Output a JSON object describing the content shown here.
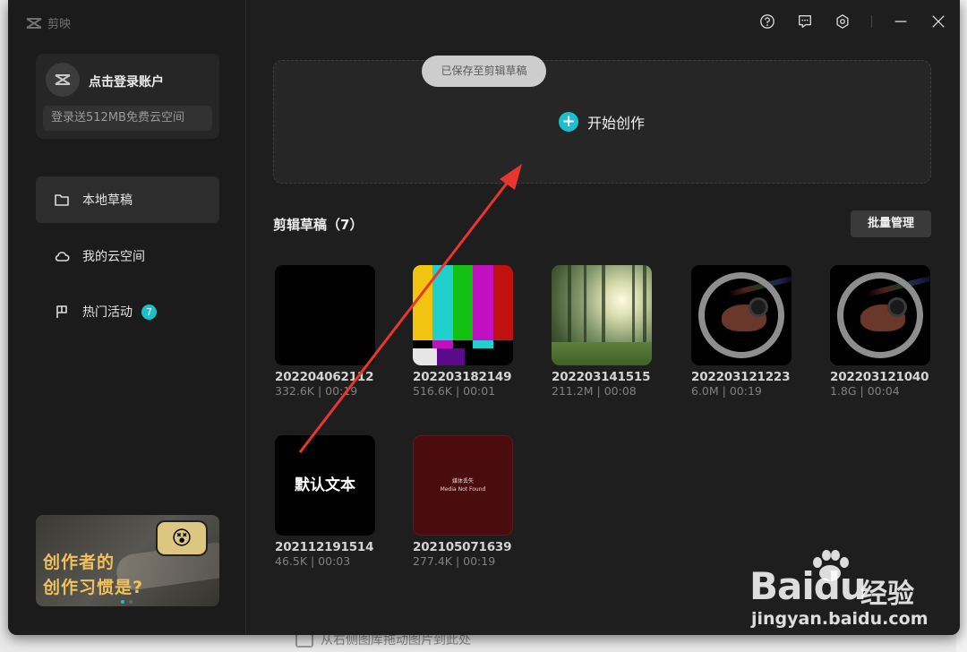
{
  "app": {
    "name": "剪映"
  },
  "account": {
    "login_label": "点击登录账户",
    "promo": "登录送512MB免费云空间"
  },
  "nav": [
    {
      "label": "本地草稿",
      "icon": "folder-icon",
      "active": true
    },
    {
      "label": "我的云空间",
      "icon": "cloud-icon",
      "active": false
    },
    {
      "label": "热门活动",
      "icon": "flag-icon",
      "active": false,
      "badge": "7"
    }
  ],
  "banner": {
    "line1": "创作者的",
    "line2": "创作习惯是?"
  },
  "topbar": {
    "icons": [
      "help-icon",
      "feedback-icon",
      "settings-icon",
      "minimize-icon",
      "close-icon"
    ]
  },
  "create": {
    "toast": "已保存至剪辑草稿",
    "label": "开始创作"
  },
  "drafts_section": {
    "title": "剪辑草稿（7）",
    "batch_label": "批量管理"
  },
  "drafts": [
    {
      "name": "202204062112",
      "meta": "332.6K | 00:19"
    },
    {
      "name": "202203182149",
      "meta": "516.6K | 00:01"
    },
    {
      "name": "202203141515",
      "meta": "211.2M | 00:08"
    },
    {
      "name": "202203121223",
      "meta": "6.0M | 00:19"
    },
    {
      "name": "202203121040",
      "meta": "1.8G | 00:04"
    },
    {
      "name": "202112191514",
      "meta": "46.5K | 00:03",
      "thumb_text": "默认文本"
    },
    {
      "name": "202105071639",
      "meta": "277.4K | 00:19",
      "thumb_text_1": "媒体丢失",
      "thumb_text_2": "Media Not Found"
    }
  ],
  "background": {
    "bottom_hint": "从右侧图库拖动图片到此处"
  },
  "watermark": {
    "brand": "Bai",
    "brand_du": "du",
    "cn": "经验",
    "url": "jingyan.baidu.com"
  },
  "colors": {
    "accent": "#1cc0cc",
    "window_bg": "#1e1e1e",
    "sidebar_bg": "#1b1b1b",
    "arrow": "#e8362f"
  }
}
